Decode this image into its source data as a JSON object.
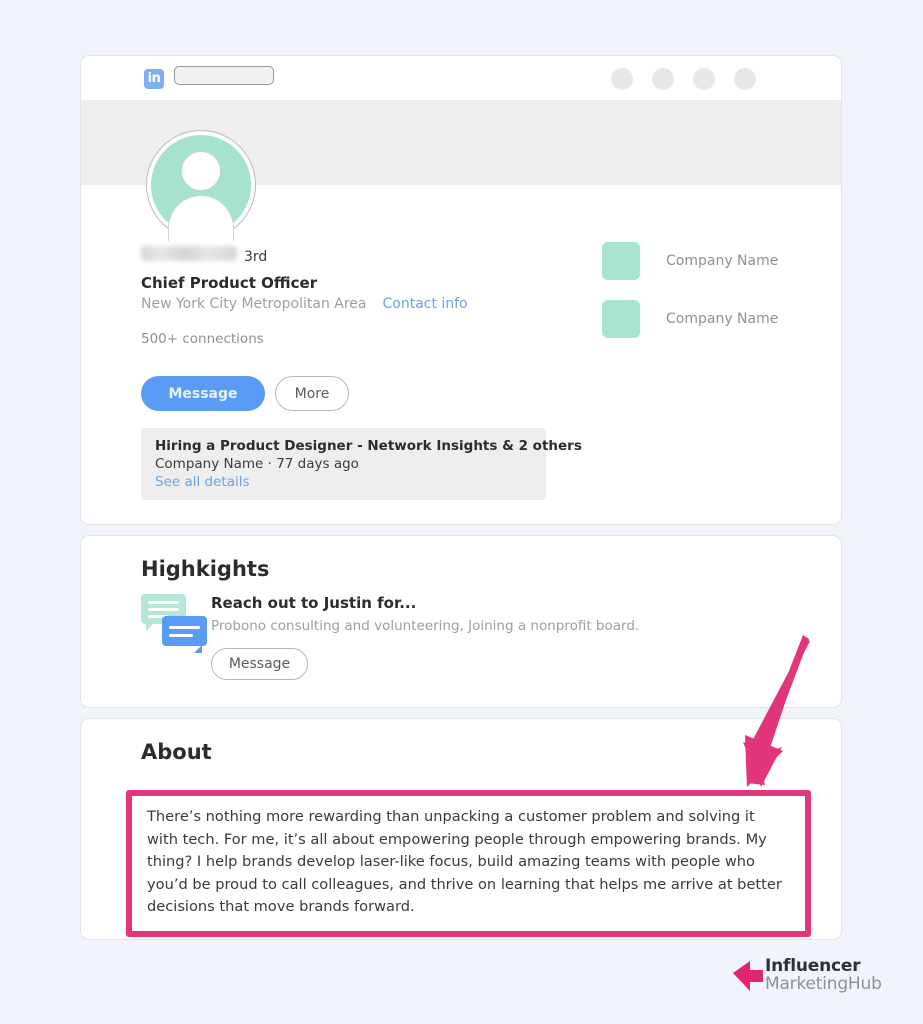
{
  "page": {
    "background_color": "#f1f5fb"
  },
  "navbar": {
    "logo_text": "in",
    "search_placeholder": "",
    "search_value": "",
    "icons": [
      "nav-dot-1",
      "nav-dot-2",
      "nav-dot-3",
      "nav-dot-4"
    ]
  },
  "profile": {
    "name": "",
    "name_redacted": true,
    "degree": "3rd",
    "headline": "Chief Product Officer",
    "location": "New York City Metropolitan Area",
    "contact_info_label": "Contact info",
    "connections": "500+ connections",
    "buttons": {
      "message": "Message",
      "more": "More"
    },
    "companies": [
      {
        "name": "Company Name"
      },
      {
        "name": "Company Name"
      }
    ],
    "activity": {
      "title": "Hiring a Product Designer - Network Insights & 2 others",
      "subtitle": "Company Name · 77 days ago",
      "link": "See all details"
    }
  },
  "highlights": {
    "title": "Highkights",
    "heading": "Reach out to Justin for...",
    "subtitle": "Probono consulting and volunteering, Joining a nonprofit board.",
    "button": "Message"
  },
  "about": {
    "title": "About",
    "text": "There’s nothing more rewarding than unpacking a customer problem and solving it with tech. For me, it’s all about empowering people through empowering brands. My thing? I help brands develop laser-like focus, build amazing teams with people who you’d be proud to call colleagues, and thrive on learning that helps me arrive at better decisions that move brands forward.",
    "highlight_color": "#e2357a"
  },
  "annotation": {
    "arrow_color": "#e2357a",
    "points_to": "about-text-highlight"
  },
  "footer": {
    "logo_line1": "Influencer",
    "logo_line2": "MarketingHub",
    "logo_mark_color": "#e2246c"
  },
  "colors": {
    "accent_blue": "#5a9cf5",
    "mint": "#a6e3cf",
    "pink": "#e2357a",
    "muted_text": "#9b9fa4"
  }
}
